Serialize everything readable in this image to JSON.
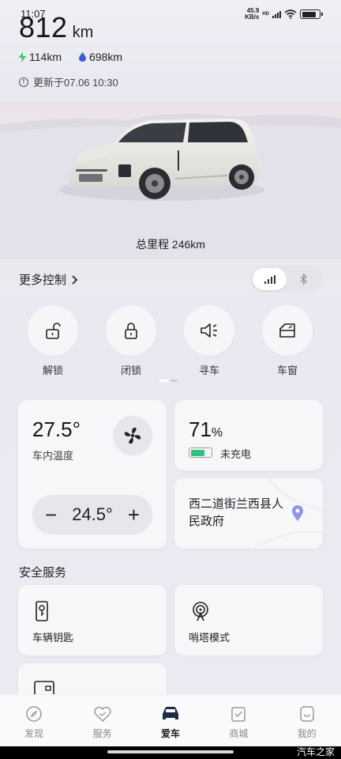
{
  "status_bar": {
    "time": "11:07",
    "net_speed": "45.9",
    "net_unit": "KB/s",
    "hd": "HD"
  },
  "range": {
    "value": "812",
    "unit": "km"
  },
  "sub_range": {
    "electric": "114km",
    "fuel": "698km"
  },
  "update_text": "更新于07.06 10:30",
  "mileage_text": "总里程 246km",
  "controls": {
    "title": "更多控制",
    "buttons": [
      {
        "label": "解锁",
        "icon": "unlock-icon"
      },
      {
        "label": "闭锁",
        "icon": "lock-icon"
      },
      {
        "label": "寻车",
        "icon": "horn-icon"
      },
      {
        "label": "车窗",
        "icon": "window-icon"
      }
    ]
  },
  "climate": {
    "cabin_temp": "27.5°",
    "cabin_label": "车内温度",
    "set_temp": "24.5°"
  },
  "battery": {
    "percent": "71",
    "percent_unit": "%",
    "status": "未充电",
    "level": 0.71
  },
  "location": {
    "address": "西二道街兰西县人民政府"
  },
  "safety": {
    "title": "安全服务",
    "items": [
      {
        "label": "车辆钥匙",
        "icon": "car-key-icon"
      },
      {
        "label": "哨塔模式",
        "icon": "sentry-icon"
      }
    ]
  },
  "tabs": [
    {
      "label": "发现",
      "icon": "compass-icon"
    },
    {
      "label": "服务",
      "icon": "heart-icon"
    },
    {
      "label": "爱车",
      "icon": "car-icon"
    },
    {
      "label": "商城",
      "icon": "bag-icon"
    },
    {
      "label": "我的",
      "icon": "smile-icon"
    }
  ],
  "watermark": "汽车之家",
  "colors": {
    "accent_green": "#2ec27e",
    "ev_green": "#3bbf5a",
    "fuel_blue": "#3a5ed8"
  }
}
